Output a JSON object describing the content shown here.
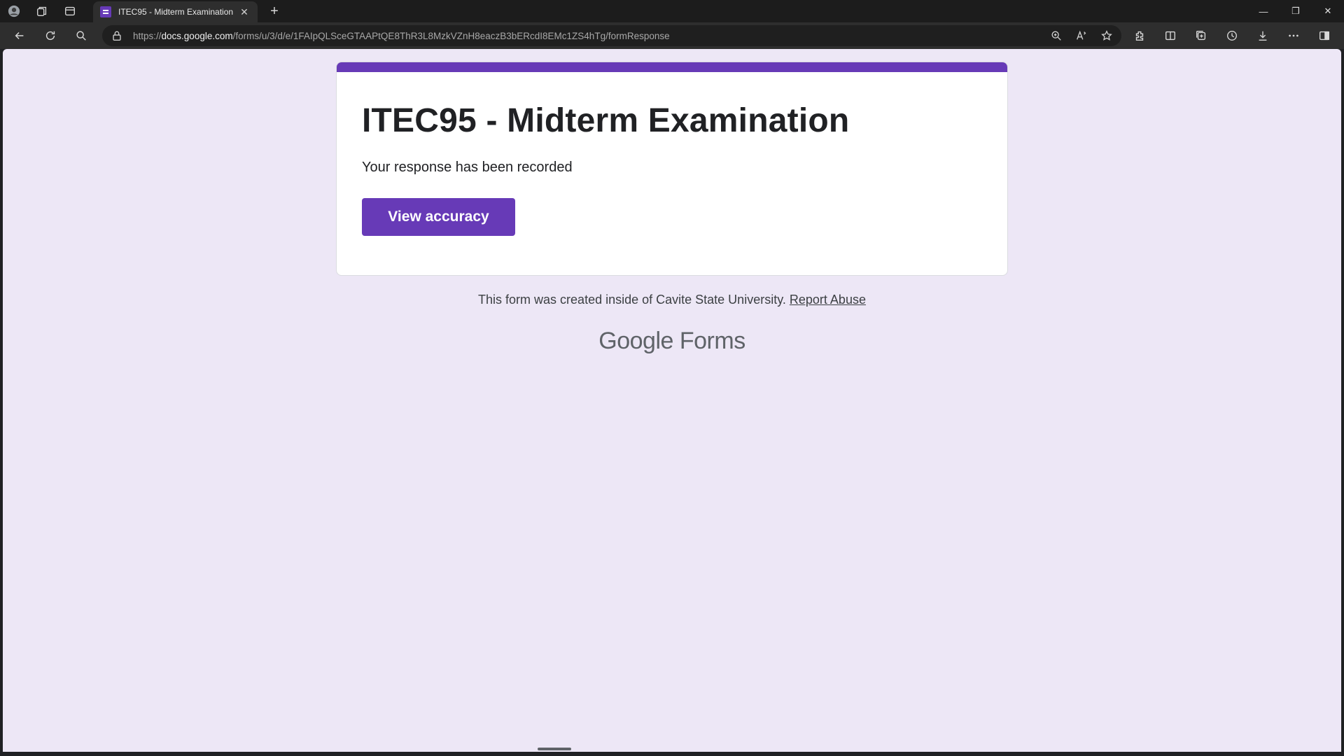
{
  "browser": {
    "tab": {
      "title": "ITEC95 - Midterm Examination",
      "close": "✕"
    },
    "new_tab": "+",
    "window_controls": {
      "minimize": "—",
      "restore": "❐",
      "close": "✕"
    },
    "url_prefix": "https://",
    "url_domain": "docs.google.com",
    "url_path": "/forms/u/3/d/e/1FAIpQLSceGTAAPtQE8ThR3L8MzkVZnH8eaczB3bERcdI8EMc1ZS4hTg/formResponse"
  },
  "form": {
    "accent_color": "#673ab7",
    "title": "ITEC95 - Midterm Examination",
    "confirmation": "Your response has been recorded",
    "view_button": "View accuracy"
  },
  "footer": {
    "text": "This form was created inside of Cavite State University.",
    "report_link": "Report Abuse"
  },
  "brand": {
    "google": "Google",
    "forms": "Forms"
  },
  "icons": [
    "profile-icon",
    "workspaces-icon",
    "tab-actions-icon",
    "back-icon",
    "refresh-icon",
    "search-icon",
    "lock-icon",
    "zoom-icon",
    "read-aloud-icon",
    "favorite-star-icon",
    "extensions-icon",
    "split-screen-icon",
    "collections-icon",
    "history-icon",
    "downloads-icon",
    "more-icon",
    "sidebar-icon"
  ]
}
